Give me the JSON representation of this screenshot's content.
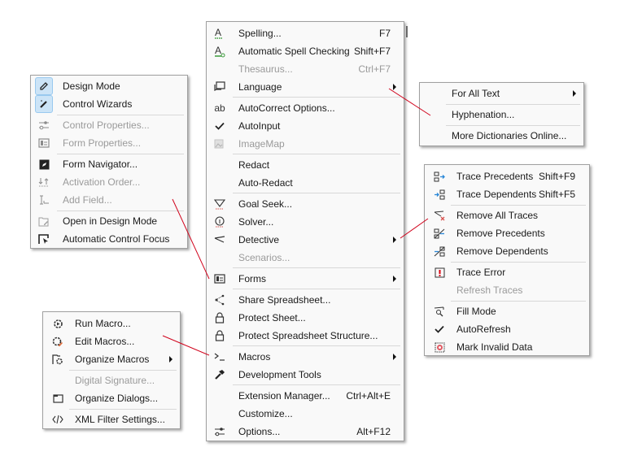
{
  "main_menu": {
    "items": [
      {
        "label": "Spelling...",
        "shortcut": "F7",
        "icon": "spelling-icon"
      },
      {
        "label": "Automatic Spell Checking",
        "shortcut": "Shift+F7",
        "icon": "auto-spellcheck-icon"
      },
      {
        "label": "Thesaurus...",
        "shortcut": "Ctrl+F7",
        "disabled": true
      },
      {
        "label": "Language",
        "submenu": true,
        "icon": "language-icon"
      },
      {
        "label": "AutoCorrect Options...",
        "icon": "autocorrect-icon"
      },
      {
        "label": "AutoInput",
        "icon": "check-icon",
        "checked": true
      },
      {
        "label": "ImageMap",
        "icon": "imagemap-icon",
        "disabled": true
      },
      {
        "label": "Redact"
      },
      {
        "label": "Auto-Redact"
      },
      {
        "label": "Goal Seek...",
        "icon": "goal-seek-icon"
      },
      {
        "label": "Solver...",
        "icon": "solver-icon"
      },
      {
        "label": "Detective",
        "submenu": true,
        "icon": "detective-icon"
      },
      {
        "label": "Scenarios...",
        "disabled": true
      },
      {
        "label": "Forms",
        "submenu": true,
        "icon": "forms-icon"
      },
      {
        "label": "Share Spreadsheet...",
        "icon": "share-icon"
      },
      {
        "label": "Protect Sheet...",
        "icon": "lock-icon"
      },
      {
        "label": "Protect Spreadsheet Structure...",
        "icon": "lock-icon"
      },
      {
        "label": "Macros",
        "submenu": true,
        "icon": "macros-icon"
      },
      {
        "label": "Development Tools",
        "icon": "hammer-icon"
      },
      {
        "label": "Extension Manager...",
        "shortcut": "Ctrl+Alt+E"
      },
      {
        "label": "Customize..."
      },
      {
        "label": "Options...",
        "shortcut": "Alt+F12",
        "icon": "options-icon"
      }
    ]
  },
  "language_menu": {
    "items": [
      {
        "label": "For All Text",
        "submenu": true
      },
      {
        "label": "Hyphenation..."
      },
      {
        "label": "More Dictionaries Online..."
      }
    ]
  },
  "forms_menu": {
    "items": [
      {
        "label": "Design Mode",
        "icon": "design-mode-icon",
        "checked": true
      },
      {
        "label": "Control Wizards",
        "icon": "control-wizards-icon",
        "checked": true
      },
      {
        "label": "Control Properties...",
        "icon": "control-properties-icon",
        "disabled": true
      },
      {
        "label": "Form Properties...",
        "icon": "form-properties-icon",
        "disabled": true
      },
      {
        "label": "Form Navigator...",
        "icon": "form-navigator-icon"
      },
      {
        "label": "Activation Order...",
        "icon": "activation-order-icon",
        "disabled": true
      },
      {
        "label": "Add Field...",
        "icon": "add-field-icon",
        "disabled": true
      },
      {
        "label": "Open in Design Mode",
        "icon": "open-design-mode-icon"
      },
      {
        "label": "Automatic Control Focus",
        "icon": "auto-control-focus-icon"
      }
    ]
  },
  "detective_menu": {
    "items": [
      {
        "label": "Trace Precedents",
        "shortcut": "Shift+F9",
        "icon": "trace-precedents-icon"
      },
      {
        "label": "Trace Dependents",
        "shortcut": "Shift+F5",
        "icon": "trace-dependents-icon"
      },
      {
        "label": "Remove All Traces",
        "icon": "remove-all-traces-icon"
      },
      {
        "label": "Remove Precedents",
        "icon": "remove-precedents-icon"
      },
      {
        "label": "Remove Dependents",
        "icon": "remove-dependents-icon"
      },
      {
        "label": "Trace Error",
        "icon": "trace-error-icon"
      },
      {
        "label": "Refresh Traces",
        "disabled": true
      },
      {
        "label": "Fill Mode",
        "icon": "fill-mode-icon"
      },
      {
        "label": "AutoRefresh",
        "icon": "check-icon",
        "checked": true
      },
      {
        "label": "Mark Invalid Data",
        "icon": "mark-invalid-icon"
      }
    ]
  },
  "macros_menu": {
    "items": [
      {
        "label": "Run Macro...",
        "icon": "run-macro-icon"
      },
      {
        "label": "Edit Macros...",
        "icon": "edit-macros-icon"
      },
      {
        "label": "Organize Macros",
        "submenu": true,
        "icon": "organize-macros-icon"
      },
      {
        "label": "Digital Signature...",
        "disabled": true
      },
      {
        "label": "Organize Dialogs...",
        "icon": "organize-dialogs-icon"
      },
      {
        "label": "XML Filter Settings...",
        "icon": "xml-filter-icon"
      }
    ]
  },
  "colors": {
    "connector_line": "#d0021b",
    "check_highlight": "#cce4f7",
    "disabled_text": "#9a9a9a"
  }
}
